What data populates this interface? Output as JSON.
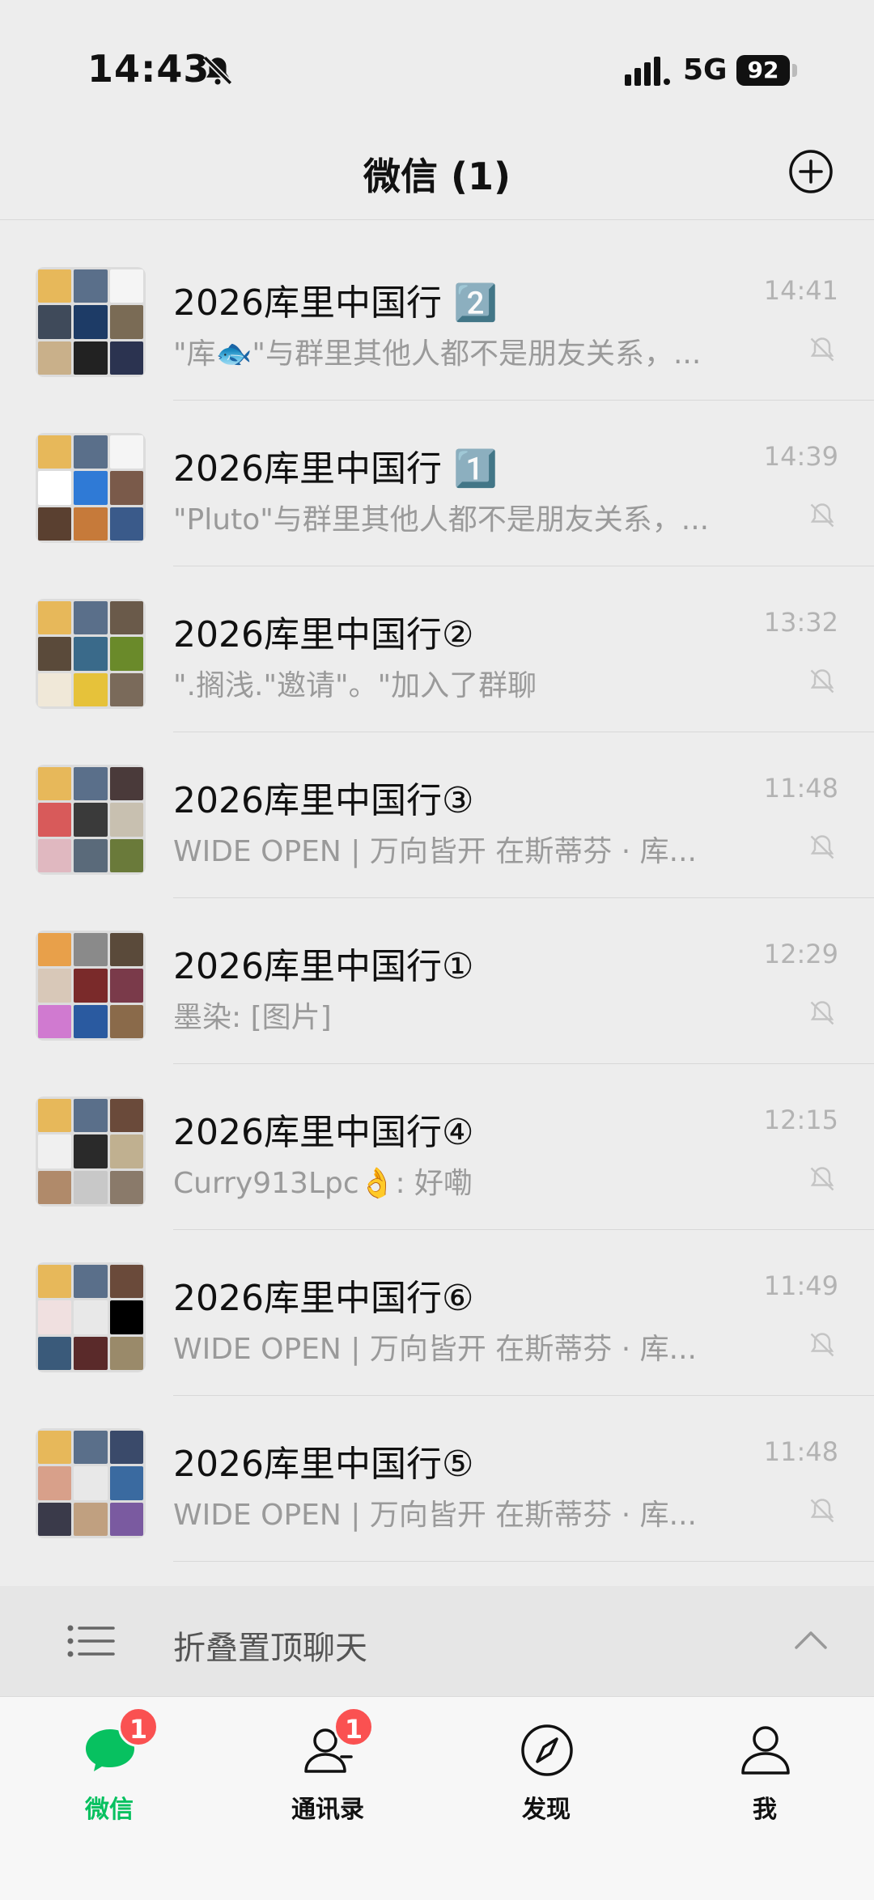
{
  "status_bar": {
    "time": "14:43",
    "network": "5G",
    "battery": "92"
  },
  "header": {
    "title": "微信 (1)"
  },
  "chats": [
    {
      "name": "2026库里中国行 2️⃣",
      "preview": "\"库🐟\"与群里其他人都不是朋友关系，...",
      "time": "14:41",
      "avatar_colors": [
        "#e7b85a",
        "#5a6f8a",
        "#f5f5f5",
        "#3f4a5a",
        "#1d3b66",
        "#7a6b55",
        "#c9b08a",
        "#222",
        "#2b3350"
      ]
    },
    {
      "name": "2026库里中国行 1️⃣",
      "preview": "\"Pluto\"与群里其他人都不是朋友关系，...",
      "time": "14:39",
      "avatar_colors": [
        "#e7b85a",
        "#5a6f8a",
        "#f5f5f5",
        "#ffffff",
        "#2f7ad6",
        "#7a5a4a",
        "#5a4030",
        "#c67a3a",
        "#3a5a8a"
      ]
    },
    {
      "name": "2026库里中国行②",
      "preview": "\".搁浅.\"邀请\"。\"加入了群聊",
      "time": "13:32",
      "avatar_colors": [
        "#e7b85a",
        "#5a6f8a",
        "#6a5a4a",
        "#5a4a3a",
        "#3a6a8a",
        "#6a8a2a",
        "#f0e8d8",
        "#e6c23a",
        "#7a6a5a"
      ]
    },
    {
      "name": "2026库里中国行③",
      "preview": "WIDE OPEN | 万向皆开   在斯蒂芬 · 库...",
      "time": "11:48",
      "avatar_colors": [
        "#e7b85a",
        "#5a6f8a",
        "#4a3a3a",
        "#d85a5a",
        "#3a3a3a",
        "#c8c0b0",
        "#e0b8c0",
        "#5a6a7a",
        "#6a7a3a"
      ]
    },
    {
      "name": "2026库里中国行①",
      "preview": "墨染: [图片]",
      "time": "12:29",
      "avatar_colors": [
        "#e8a04a",
        "#8a8a8a",
        "#5a4a3a",
        "#d8c8b8",
        "#7a2a2a",
        "#7a3a4a",
        "#d07ad0",
        "#2a5aa0",
        "#8a6a4a"
      ]
    },
    {
      "name": "2026库里中国行④",
      "preview": "Curry913Lpc👌: 好嘞",
      "time": "12:15",
      "avatar_colors": [
        "#e7b85a",
        "#5a6f8a",
        "#6a4a3a",
        "#f0f0f0",
        "#2a2a2a",
        "#c0b090",
        "#b08a6a",
        "#c8c8c8",
        "#8a7a6a"
      ]
    },
    {
      "name": "2026库里中国行⑥",
      "preview": "WIDE OPEN | 万向皆开   在斯蒂芬 · 库...",
      "time": "11:49",
      "avatar_colors": [
        "#e7b85a",
        "#5a6f8a",
        "#6a4a3a",
        "#f0e0e0",
        "#e8e8e8",
        "#000000",
        "#3a5a7a",
        "#5a2a2a",
        "#9a8a6a"
      ]
    },
    {
      "name": "2026库里中国行⑤",
      "preview": "WIDE OPEN | 万向皆开   在斯蒂芬 · 库...",
      "time": "11:48",
      "avatar_colors": [
        "#e7b85a",
        "#5a6f8a",
        "#3a4a6a",
        "#d8a08a",
        "#e8e8e8",
        "#3a6aa0",
        "#3a3a4a",
        "#c0a080",
        "#7a5aa0"
      ]
    }
  ],
  "fold_bar": {
    "label": "折叠置顶聊天"
  },
  "tabs": [
    {
      "label": "微信",
      "badge": "1",
      "active": true
    },
    {
      "label": "通讯录",
      "badge": "1",
      "active": false
    },
    {
      "label": "发现",
      "badge": "",
      "active": false
    },
    {
      "label": "我",
      "badge": "",
      "active": false
    }
  ],
  "colors": {
    "accent": "#07c160",
    "badge": "#fa5151",
    "background": "#ededed"
  }
}
